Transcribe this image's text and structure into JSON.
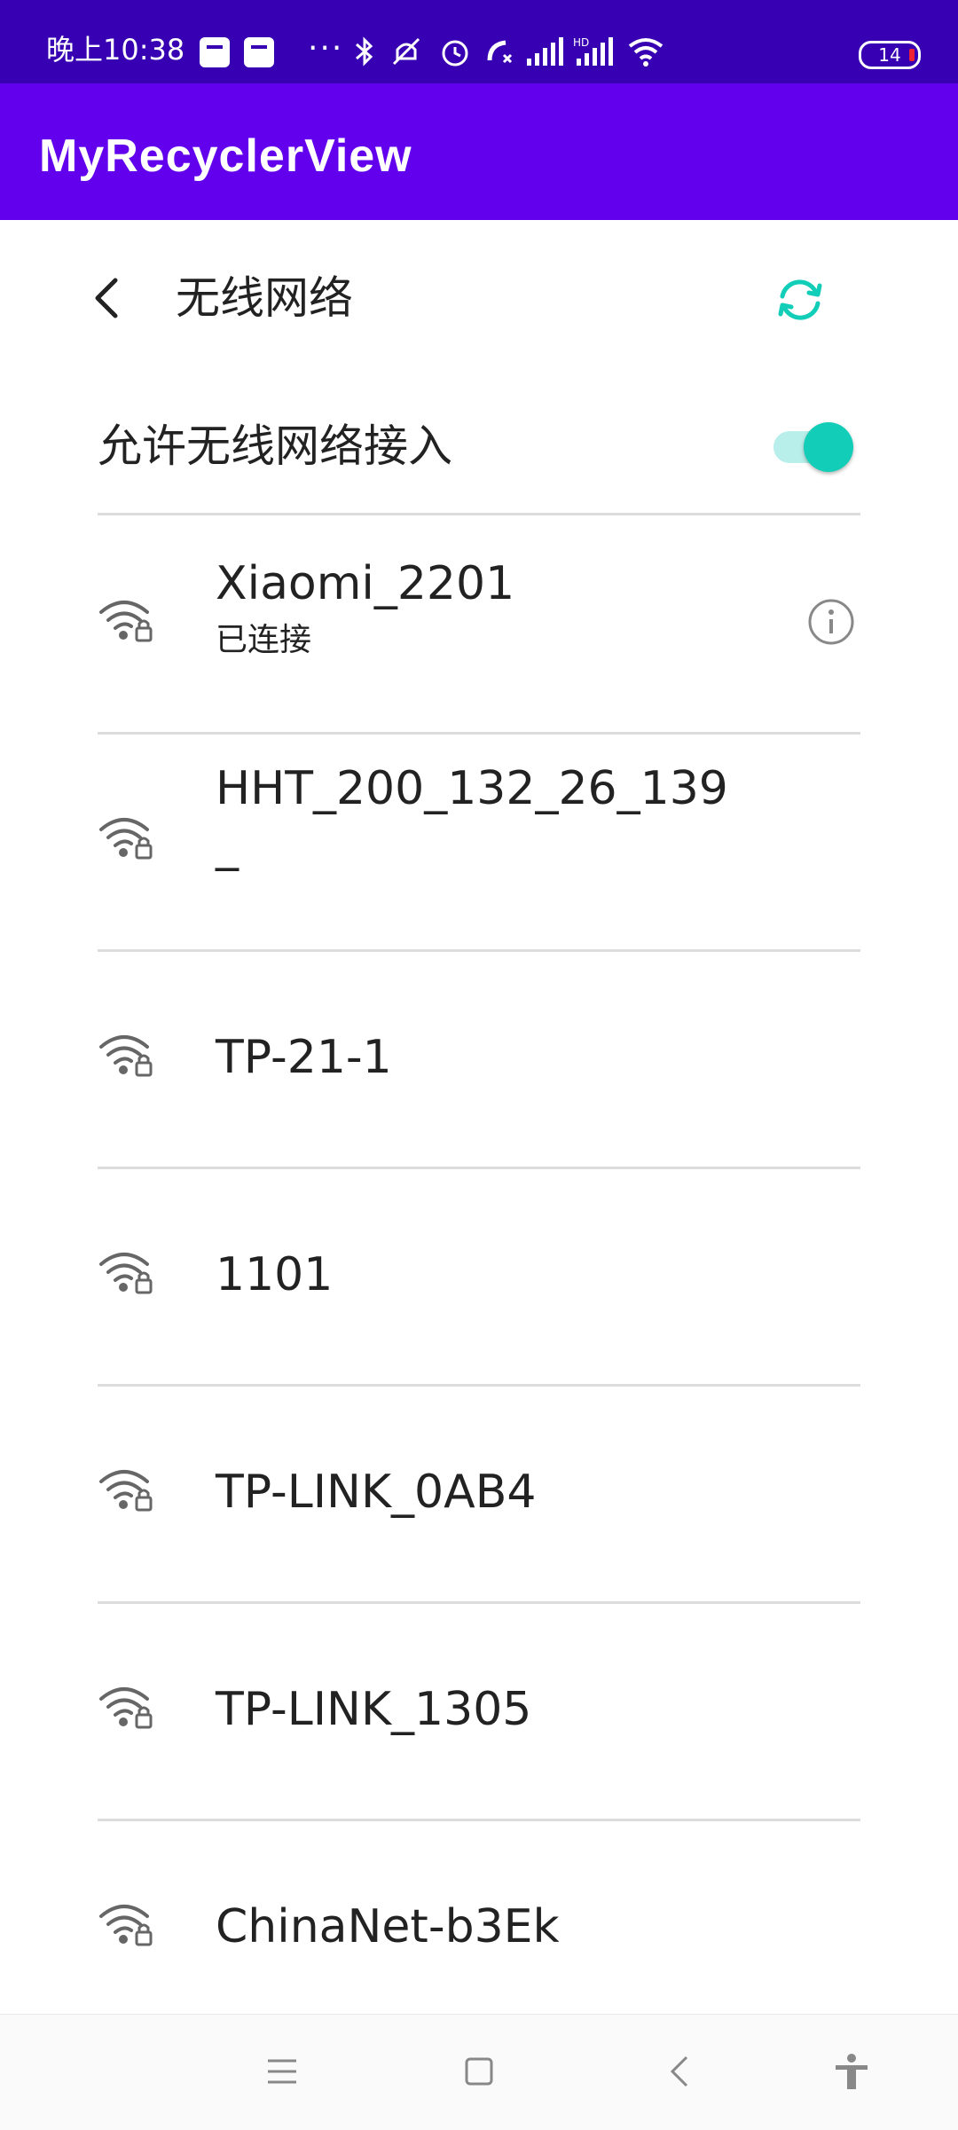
{
  "status_bar": {
    "time": "晚上10:38",
    "dots": "···",
    "battery": "14",
    "icons": [
      "mi-notification-icon",
      "mi-notification-icon",
      "bluetooth-icon",
      "mute-icon",
      "alarm-icon",
      "call-icon",
      "signal-icon",
      "hd-signal-icon",
      "wifi-icon",
      "battery-icon"
    ]
  },
  "app_bar": {
    "title": "MyRecyclerView"
  },
  "header": {
    "title": "无线网络"
  },
  "toggle": {
    "label": "允许无线网络接入",
    "enabled": true
  },
  "networks": [
    {
      "name": "Xiaomi_2201",
      "status": "已连接",
      "info": true
    },
    {
      "name": "HHT_200_132_26_139",
      "name_line2": "_",
      "status": ""
    },
    {
      "name": "TP-21-1",
      "status": ""
    },
    {
      "name": "1101",
      "status": ""
    },
    {
      "name": "TP-LINK_0AB4",
      "status": ""
    },
    {
      "name": "TP-LINK_1305",
      "status": ""
    },
    {
      "name": "ChinaNet-b3Ek",
      "status": ""
    }
  ],
  "nav_bar": {
    "buttons": [
      "menu-icon",
      "home-icon",
      "back-icon",
      "accessibility-icon"
    ]
  },
  "colors": {
    "status_bar": "#3700b3",
    "app_bar": "#6200ee",
    "accent": "#12cdb8"
  }
}
